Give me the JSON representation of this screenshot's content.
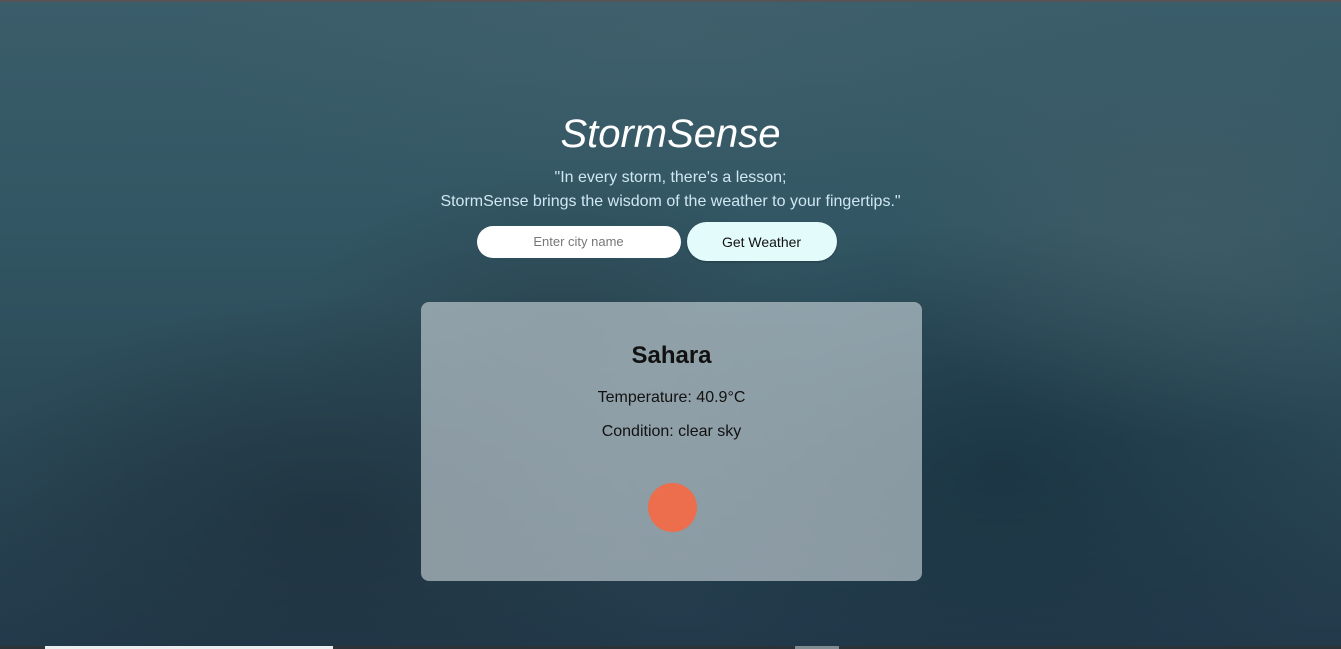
{
  "app": {
    "title": "StormSense",
    "tagline_line1": "\"In every storm, there's a lesson;",
    "tagline_line2": "StormSense brings the wisdom of the weather to your fingertips.\""
  },
  "search": {
    "placeholder": "Enter city name",
    "value": "",
    "button_label": "Get Weather"
  },
  "weather": {
    "city": "Sahara",
    "temperature_text": "Temperature: 40.9°C",
    "condition_text": "Condition: clear sky",
    "icon": "sun-icon",
    "icon_color": "#ec6e4c"
  },
  "colors": {
    "button_bg": "#e3fbfb",
    "tagline": "#cfe7f2"
  }
}
